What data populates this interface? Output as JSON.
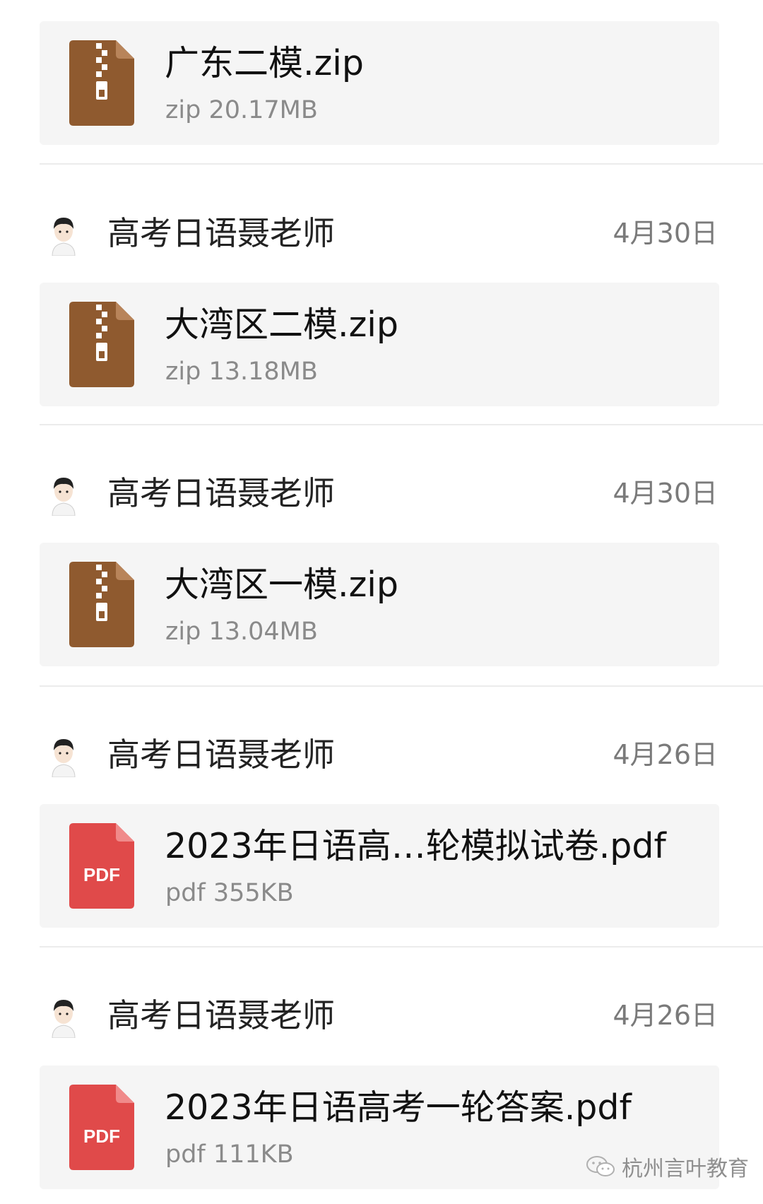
{
  "items": [
    {
      "sender": null,
      "file": {
        "name": "广东二模.zip",
        "meta": "zip 20.17MB",
        "icon": "zip-file-icon"
      }
    },
    {
      "sender": {
        "name": "高考日语聂老师",
        "date": "4月30日"
      },
      "file": {
        "name": "大湾区二模.zip",
        "meta": "zip 13.18MB",
        "icon": "zip-file-icon"
      }
    },
    {
      "sender": {
        "name": "高考日语聂老师",
        "date": "4月30日"
      },
      "file": {
        "name": "大湾区一模.zip",
        "meta": "zip 13.04MB",
        "icon": "zip-file-icon"
      }
    },
    {
      "sender": {
        "name": "高考日语聂老师",
        "date": "4月26日"
      },
      "file": {
        "name": "2023年日语高…轮模拟试卷.pdf",
        "meta": "pdf 355KB",
        "icon": "pdf-file-icon",
        "icon_label": "PDF"
      }
    },
    {
      "sender": {
        "name": "高考日语聂老师",
        "date": "4月26日"
      },
      "file": {
        "name": "2023年日语高考一轮答案.pdf",
        "meta": "pdf 111KB",
        "icon": "pdf-file-icon",
        "icon_label": "PDF"
      }
    }
  ],
  "watermark": {
    "text": "杭州言叶教育",
    "icon": "wechat-logo-icon"
  },
  "colors": {
    "zip": "#8f5a2f",
    "zip_fold": "#b8845a",
    "pdf": "#e04a4a",
    "pdf_fold": "#f08a8a",
    "card_bg": "#f5f5f5"
  }
}
